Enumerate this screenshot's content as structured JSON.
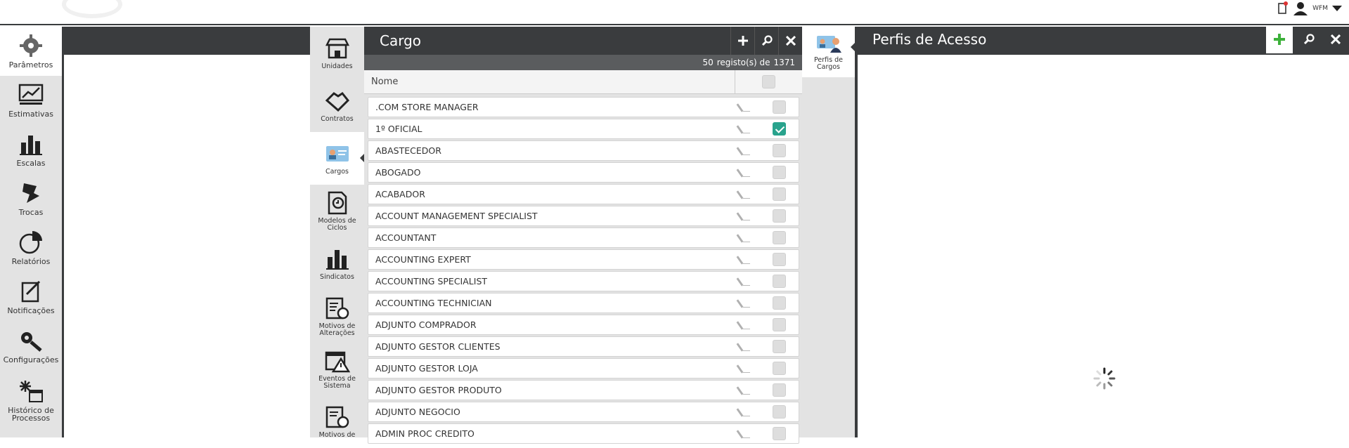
{
  "topbar": {
    "username": "WFM"
  },
  "leftnav": {
    "items": [
      {
        "label": "Parâmetros",
        "icon": "gear-icon"
      },
      {
        "label": "Estimativas",
        "icon": "chart-monitor-icon"
      },
      {
        "label": "Escalas",
        "icon": "bar-chart-icon"
      },
      {
        "label": "Trocas",
        "icon": "swap-icon"
      },
      {
        "label": "Relatórios",
        "icon": "pie-chart-icon"
      },
      {
        "label": "Notificações",
        "icon": "notification-icon"
      },
      {
        "label": "Configurações",
        "icon": "tools-icon"
      },
      {
        "label": "Histórico de Processos",
        "icon": "history-calendar-icon"
      }
    ]
  },
  "subnav": {
    "items": [
      {
        "label": "Unidades",
        "icon": "store-icon"
      },
      {
        "label": "Contratos",
        "icon": "handshake-icon"
      },
      {
        "label": "Cargos",
        "icon": "id-card-icon"
      },
      {
        "label": "Modelos de Ciclos",
        "icon": "cycle-doc-icon"
      },
      {
        "label": "Sindicatos",
        "icon": "bar-chart-icon"
      },
      {
        "label": "Motivos de Alterações",
        "icon": "list-refresh-icon"
      },
      {
        "label": "Eventos de Sistema",
        "icon": "calendar-warning-icon"
      },
      {
        "label": "Motivos de",
        "icon": "list-refresh-icon"
      }
    ]
  },
  "cargo": {
    "title": "Cargo",
    "count_shown": "50",
    "count_text": "registo(s) de",
    "count_total": "1371",
    "column_name": "Nome",
    "rows": [
      {
        "name": ".COM STORE MANAGER",
        "checked": false
      },
      {
        "name": "1º OFICIAL",
        "checked": true
      },
      {
        "name": "ABASTECEDOR",
        "checked": false
      },
      {
        "name": "ABOGADO",
        "checked": false
      },
      {
        "name": "ACABADOR",
        "checked": false
      },
      {
        "name": "ACCOUNT MANAGEMENT SPECIALIST",
        "checked": false
      },
      {
        "name": "ACCOUNTANT",
        "checked": false
      },
      {
        "name": "ACCOUNTING EXPERT",
        "checked": false
      },
      {
        "name": "ACCOUNTING SPECIALIST",
        "checked": false
      },
      {
        "name": "ACCOUNTING TECHNICIAN",
        "checked": false
      },
      {
        "name": "ADJUNTO COMPRADOR",
        "checked": false
      },
      {
        "name": "ADJUNTO GESTOR CLIENTES",
        "checked": false
      },
      {
        "name": "ADJUNTO GESTOR LOJA",
        "checked": false
      },
      {
        "name": "ADJUNTO GESTOR PRODUTO",
        "checked": false
      },
      {
        "name": "ADJUNTO NEGOCIO",
        "checked": false
      },
      {
        "name": "ADMIN PROC CREDITO",
        "checked": false
      }
    ]
  },
  "perfisnav": {
    "label": "Perfis de Cargos"
  },
  "perfis": {
    "title": "Perfis de Acesso"
  },
  "colors": {
    "dark": "#3a3c3e",
    "checked": "#29a38d",
    "add": "#3db13b",
    "panel": "#e3e3e3"
  }
}
